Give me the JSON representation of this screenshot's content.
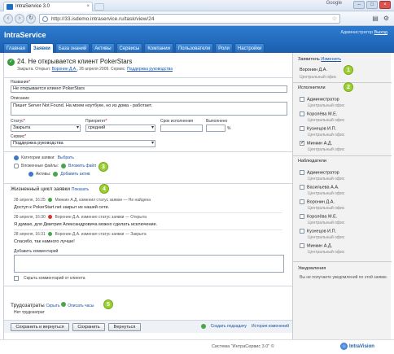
{
  "browser": {
    "tab_title": "IntraService 3.0",
    "url": "http://33.isdemo.intraservice.ru/task/view/24",
    "search_engine": "Google"
  },
  "app": {
    "brand": "IntraService",
    "user_label": "Администратор",
    "logout": "Выход",
    "nav": [
      "Главная",
      "Заявки",
      "База знаний",
      "Активы",
      "Сервисы",
      "Компании",
      "Пользователи",
      "Роли",
      "Настройки"
    ],
    "active_nav": "Заявки"
  },
  "ticket": {
    "title": "24. Не открывается клиент PokerStars",
    "meta_prefix": "Закрыта. Открыл:",
    "opened_by": "Воронин Д.А.",
    "meta_date": ", 28 апреля 2009. Сервис:",
    "service_link": "Поддержка руководства",
    "name_label": "Название",
    "name_value": "Не открывается клиент PokerStars",
    "desc_label": "Описание",
    "desc_value": "Пишет Server Not Found. На моем ноутбуке, но из дома - работает.",
    "status_label": "Статус",
    "status_value": "Закрыта",
    "priority_label": "Приоритет",
    "priority_value": "средний",
    "deadline_label": "Срок исполнения",
    "deadline_value": "",
    "done_label": "Выполнено",
    "done_value": "",
    "done_unit": "%",
    "service_label": "Сервис",
    "service_value": "Поддержка руководства",
    "categories_label": "Категории заявки:",
    "categories_link": "Выбрать",
    "files_label": "Вложенные файлы:",
    "files_link": "Вложить файл",
    "assets_label": "Активы:",
    "assets_link": "Добавить актив"
  },
  "lifecycle": {
    "title": "Жизненный цикл заявки",
    "show_link": "Показать",
    "events": [
      {
        "time": "28 апреля, 16:25",
        "author": "Минкин А.Д. изменил статус заявки",
        "change": "— Не найдена",
        "message": "Доступ к PokerStart.net закрыт из нашей сети."
      },
      {
        "time": "28 апреля, 16:30",
        "author": "Воронин Д.А. изменил статус заявки",
        "change": "— Открыта",
        "message": "Я думаю, для Дмитрия Александровича можно сделать исключение."
      },
      {
        "time": "28 апреля, 16:31",
        "author": "Воронин Д.А. изменил статус заявки",
        "change": "— Закрыта",
        "message": "Спасибо, так намного лучше!"
      }
    ],
    "add_comment_label": "Добавить комментарий",
    "hide_comment_label": "Скрыть комментарий от клиента"
  },
  "labor": {
    "title": "Трудозатраты",
    "hide_link": "Скрыть",
    "describe_link": "Описать часы",
    "empty": "Нет трудозатрат"
  },
  "buttons": {
    "save_return": "Сохранить и вернуться",
    "save": "Сохранить",
    "back": "Вернуться",
    "create_subtask": "Создать подзадачу",
    "task_history": "История изменений"
  },
  "sidebar": {
    "applicant_title": "Заявитель",
    "applicant_change": "Изменить",
    "applicant_name": "Воронин Д.А.",
    "applicant_org": "Центральный офис",
    "executors_title": "Исполнители",
    "executors": [
      {
        "name": "Администратор",
        "org": "Центральный офис",
        "checked": false
      },
      {
        "name": "Королёва М.Е.",
        "org": "Центральный офис",
        "checked": false
      },
      {
        "name": "Кузнецов И.П.",
        "org": "Центральный офис",
        "checked": false
      },
      {
        "name": "Минкин А.Д.",
        "org": "Центральный офис",
        "checked": true
      }
    ],
    "observers_title": "Наблюдатели",
    "observers": [
      {
        "name": "Администратор",
        "org": "Центральный офис"
      },
      {
        "name": "Васильева А.А.",
        "org": "Центральный офис"
      },
      {
        "name": "Воронин Д.А.",
        "org": "Центральный офис"
      },
      {
        "name": "Королёва М.Е.",
        "org": "Центральный офис"
      },
      {
        "name": "Кузнецов И.П.",
        "org": "Центральный офис"
      },
      {
        "name": "Минкин А.Д.",
        "org": "Центральный офис"
      }
    ],
    "notify_title": "Уведомления",
    "notify_text": "Вы не получаете уведомлений по этой заявке."
  },
  "markers": [
    "1",
    "2",
    "3",
    "4",
    "5"
  ],
  "footer": {
    "copyright": "Система \"ИнтраСервис 3.0\" ©",
    "logo": "IntraVision"
  }
}
